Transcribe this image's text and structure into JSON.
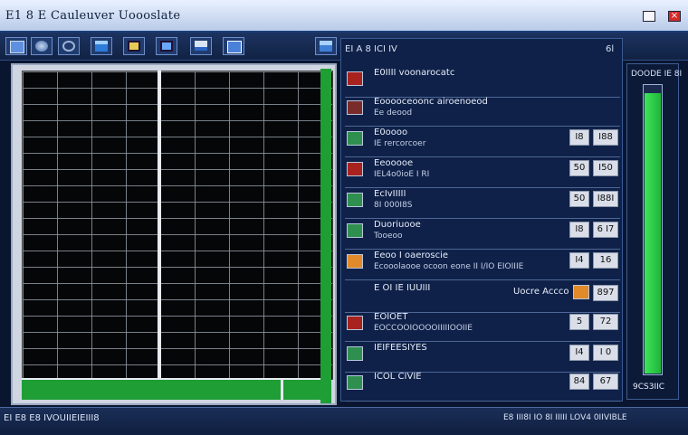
{
  "window": {
    "title": "E1 8 E Cauleuver Uoooslate",
    "close_glyph": "×"
  },
  "toolbar": {
    "buttons": [
      {
        "icon": "window-icon"
      },
      {
        "icon": "disk-icon"
      },
      {
        "icon": "eye-icon"
      },
      {
        "icon": "monitor-icon"
      },
      {
        "icon": "folder-icon"
      },
      {
        "icon": "folder-open-icon"
      },
      {
        "icon": "display-icon"
      },
      {
        "icon": "screen-icon"
      },
      {
        "icon": "app-icon"
      }
    ]
  },
  "panel": {
    "header": "EI A 8 ICI IV",
    "header_right": "6l",
    "rows": [
      {
        "label": "E0IIII voonarocatc",
        "sub": "",
        "icon": "ico-red"
      },
      {
        "label": "Eooooceoonc airoenoeod",
        "sub": "Ee deood",
        "icon": "ico-brown"
      },
      {
        "label": "E0oooo",
        "sub": "IE rercorcoer",
        "icon": "ico-green",
        "v1": "I8",
        "v2": "I88"
      },
      {
        "label": "Eeooooe",
        "sub": "IEL4o0ioE I RI",
        "icon": "ico-red",
        "v1": "50",
        "v2": "I50"
      },
      {
        "label": "EcIvIIIII",
        "sub": "8I 000I8S",
        "icon": "ico-green",
        "v1": "50",
        "v2": "I88I"
      },
      {
        "label": "Duoriuooe",
        "sub": "Tooeoo",
        "icon": "ico-green",
        "v1": "I8",
        "v2": "6 I7"
      },
      {
        "label": "Eeoo I oaeroscie",
        "sub": "Ecooolaooe ocoon eone II I/IO EIOIIIE",
        "icon": "ico-orange",
        "v1": "I4",
        "v2": "16"
      },
      {
        "label": "E OI IE IUUIII",
        "sub": "",
        "icon": "",
        "mid": "Uocre Accco",
        "v2": "897"
      },
      {
        "label": "EOIOET",
        "sub": "EOCCOOIOOOOIIIIIOOIIE",
        "icon": "ico-red",
        "v1": "5",
        "v2": "72"
      },
      {
        "label": "IEIFEESIYES",
        "sub": "",
        "icon": "ico-green",
        "v1": "I4",
        "v2": "I 0"
      },
      {
        "label": "ICOL CIVIE",
        "sub": "",
        "icon": "ico-green",
        "v1": "84",
        "v2": "67"
      }
    ]
  },
  "meter": {
    "title": "DOODE IE 8I",
    "value_text": "9CS3IIC",
    "fill": 0.97
  },
  "status": {
    "left": "EI E8 E8 IVOUIIEIEIII8",
    "right": "E8 III8I IO 8I IIIII LOV4 0IIVIBLE"
  }
}
